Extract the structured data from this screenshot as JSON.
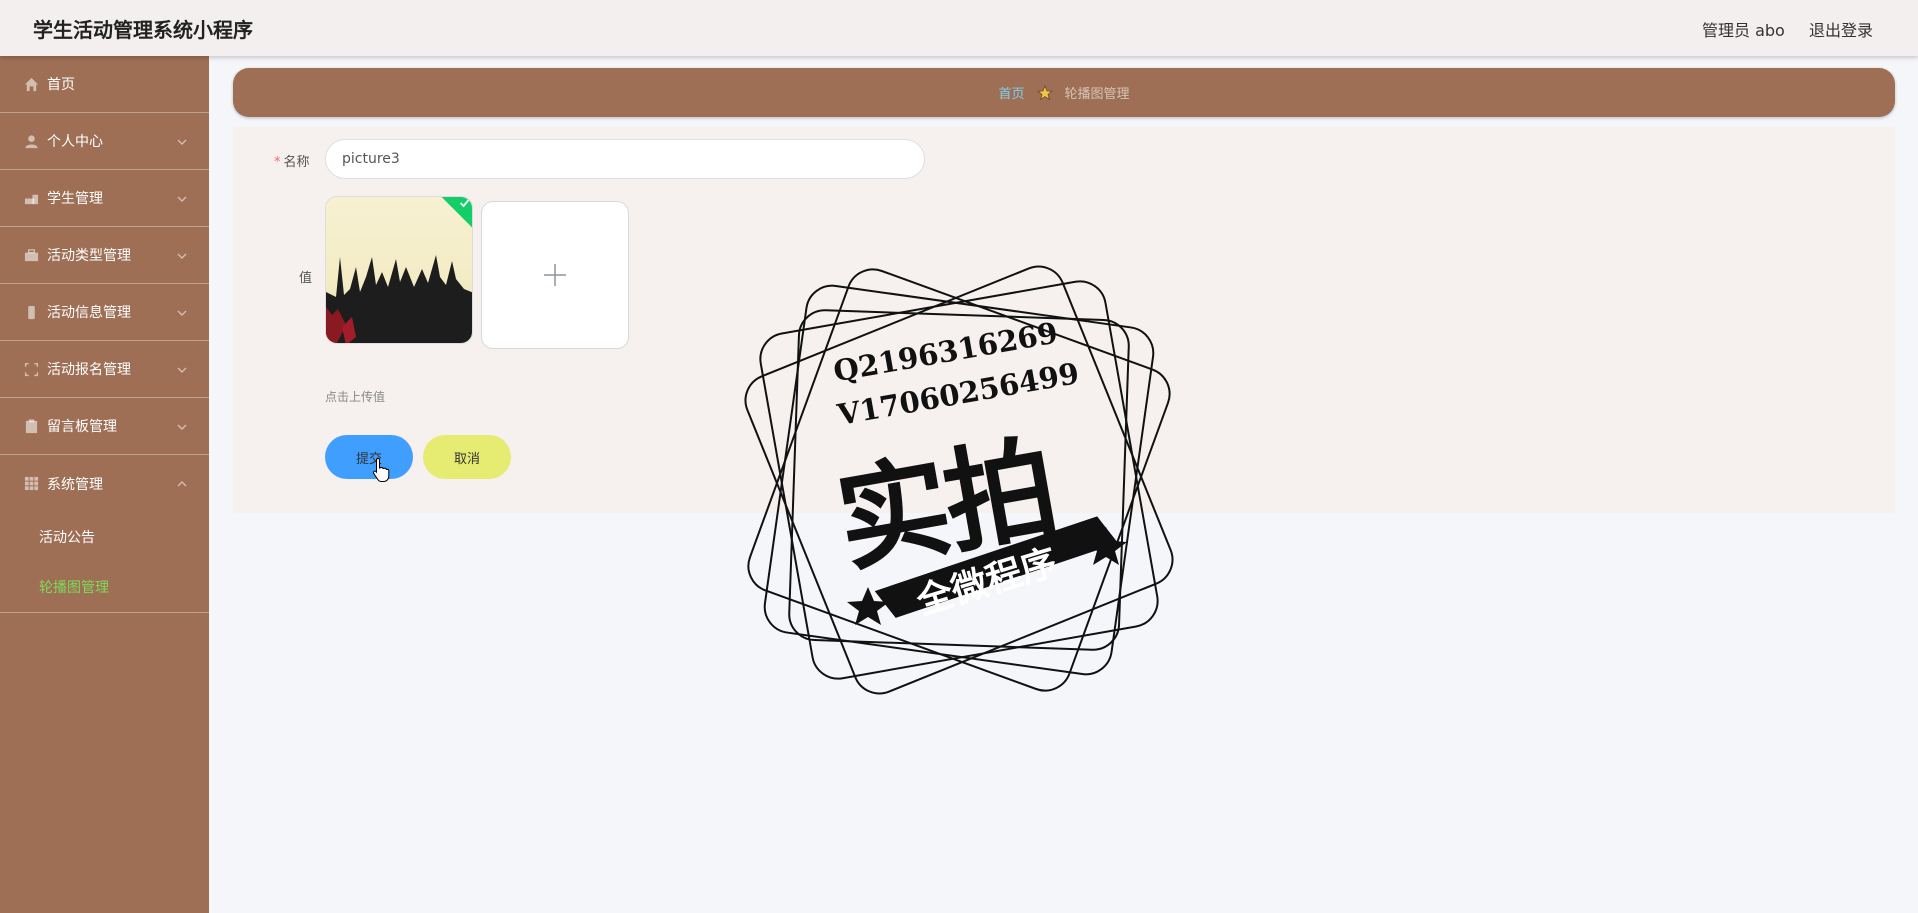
{
  "header": {
    "title": "学生活动管理系统小程序",
    "admin": "管理员 abo",
    "logout": "退出登录"
  },
  "sidebar": {
    "items": [
      {
        "label": "首页",
        "icon": "home-icon"
      },
      {
        "label": "个人中心",
        "icon": "user-icon"
      },
      {
        "label": "学生管理",
        "icon": "student-icon"
      },
      {
        "label": "活动类型管理",
        "icon": "briefcase-icon"
      },
      {
        "label": "活动信息管理",
        "icon": "phone-icon"
      },
      {
        "label": "活动报名管理",
        "icon": "frame-icon"
      },
      {
        "label": "留言板管理",
        "icon": "clipboard-icon"
      },
      {
        "label": "系统管理",
        "icon": "grid-icon"
      }
    ],
    "sub_items": [
      {
        "label": "活动公告",
        "active": false
      },
      {
        "label": "轮播图管理",
        "active": true
      }
    ]
  },
  "breadcrumb": {
    "home": "首页",
    "current": "轮播图管理"
  },
  "form": {
    "name_label": "名称",
    "name_value": "picture3",
    "value_label": "值",
    "upload_tip": "点击上传值",
    "submit": "提交",
    "cancel": "取消"
  },
  "watermark": {
    "line1": "Q2196316269",
    "line2": "V17060256499",
    "big": "实拍",
    "ribbon": "全微程序"
  },
  "colors": {
    "sidebar_bg": "#9e6f55",
    "active_sub": "#7ed957",
    "submit_bg": "#409eff",
    "cancel_bg": "#e6ec71"
  }
}
